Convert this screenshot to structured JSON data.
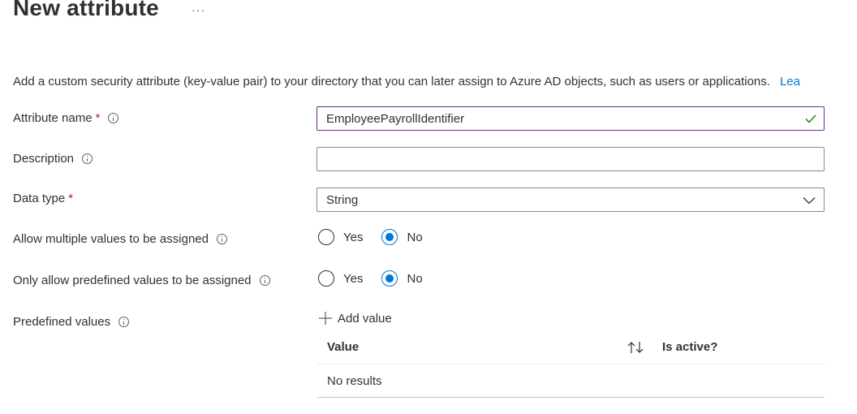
{
  "header": {
    "title": "New attribute",
    "more_label": "···"
  },
  "intro": {
    "text": "Add a custom security attribute (key-value pair) to your directory that you can later assign to Azure AD objects, such as users or applications.",
    "link_label": "Lea"
  },
  "form": {
    "attribute_name": {
      "label": "Attribute name",
      "required_mark": "*",
      "value": "EmployeePayrollIdentifier",
      "valid_icon": "check-icon"
    },
    "description": {
      "label": "Description",
      "value": ""
    },
    "data_type": {
      "label": "Data type",
      "required_mark": "*",
      "value": "String",
      "dropdown_icon": "chevron-down-icon"
    },
    "allow_multiple": {
      "label": "Allow multiple values to be assigned",
      "options": [
        "Yes",
        "No"
      ],
      "selected": "No"
    },
    "only_predefined": {
      "label": "Only allow predefined values to be assigned",
      "options": [
        "Yes",
        "No"
      ],
      "selected": "No"
    },
    "predefined_values": {
      "label": "Predefined values",
      "add_label": "Add value",
      "table": {
        "columns": [
          "Value",
          "Is active?"
        ],
        "empty_text": "No results"
      }
    }
  },
  "colors": {
    "accent": "#0078d4",
    "required": "#a4262c",
    "valid": "#107c10",
    "focus_border": "#6b2f8f",
    "link": "#0078d4"
  }
}
